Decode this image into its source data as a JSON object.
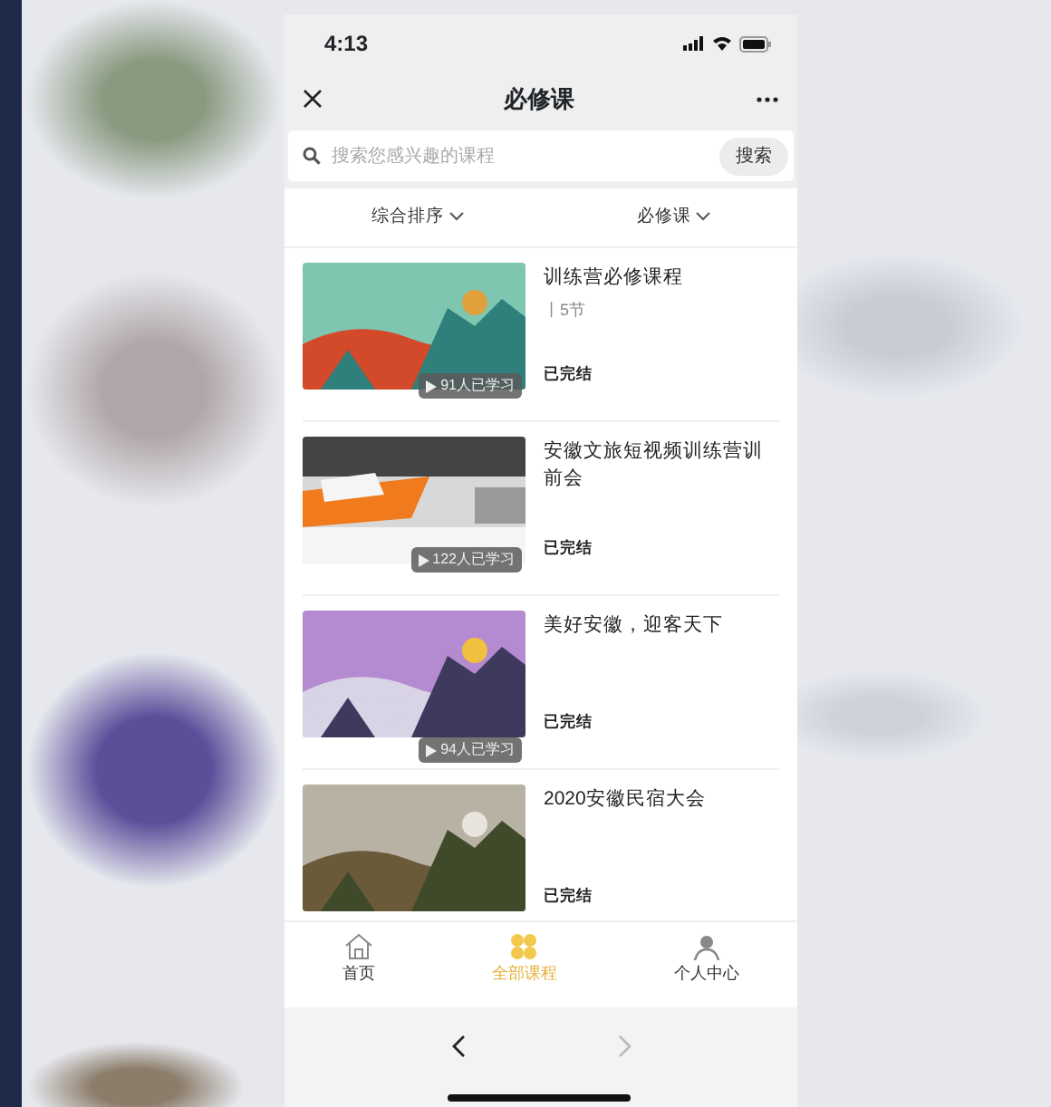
{
  "status_bar": {
    "time": "4:13"
  },
  "nav_bar": {
    "title": "必修课"
  },
  "search": {
    "placeholder": "搜索您感兴趣的课程",
    "button": "搜索"
  },
  "filters": [
    {
      "label": "综合排序"
    },
    {
      "label": "必修课"
    }
  ],
  "courses": [
    {
      "title": "训练营必修课程",
      "lessons": "丨5节",
      "status": "已完结",
      "learners": "91人已学习"
    },
    {
      "title": "安徽文旅短视频训练营训前会",
      "status": "已完结",
      "learners": "122人已学习"
    },
    {
      "title": "美好安徽，迎客天下",
      "status": "已完结",
      "learners": "94人已学习"
    },
    {
      "title": "2020安徽民宿大会",
      "status": "已完结"
    }
  ],
  "tabs": [
    {
      "label": "首页",
      "selected": false
    },
    {
      "label": "全部课程",
      "selected": true
    },
    {
      "label": "个人中心",
      "selected": false
    }
  ],
  "browser_nav": {
    "back_disabled": false,
    "forward_disabled": true
  }
}
